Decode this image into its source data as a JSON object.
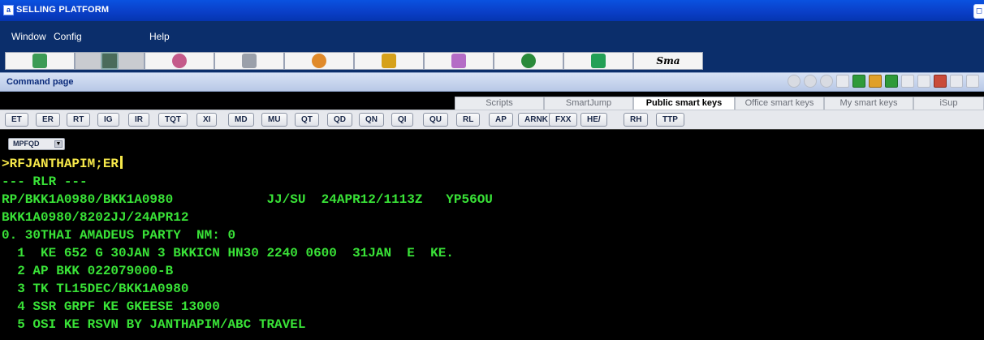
{
  "window": {
    "title": "SELLING PLATFORM",
    "app_icon": "a"
  },
  "menu": {
    "items": [
      "Window",
      "Config",
      "Help"
    ]
  },
  "toolbar": {
    "buttons": [
      {
        "icon": "book-icon",
        "color": "#3c9b55"
      },
      {
        "icon": "terminal-icon",
        "color": "#4a6b5a"
      },
      {
        "icon": "agent-icon",
        "color": "#c45a8a"
      },
      {
        "icon": "plane-icon",
        "color": "#9aa0aa"
      },
      {
        "icon": "globe-icon",
        "color": "#e08a2a"
      },
      {
        "icon": "people-icon",
        "color": "#d6a11b"
      },
      {
        "icon": "notes-icon",
        "color": "#b46cc6"
      },
      {
        "icon": "info-icon",
        "color": "#2a8a3a"
      },
      {
        "icon": "highlighter-icon",
        "color": "#23a056"
      }
    ],
    "sma_label": "Sma"
  },
  "command_page": {
    "title": "Command page"
  },
  "smartkey_tabs": [
    "Scripts",
    "SmartJump",
    "Public smart keys",
    "Office smart keys",
    "My smart keys",
    "iSup"
  ],
  "smartkeys": [
    "ET",
    "ER",
    "RT",
    "IG",
    "IR",
    "TQT",
    "XI",
    "MD",
    "MU",
    "QT",
    "QD",
    "QN",
    "QI",
    "QU",
    "RL",
    "AP",
    "ARNK",
    "FXX",
    "HE/",
    "RH",
    "TTP"
  ],
  "office_select": {
    "value": "MPFQD"
  },
  "terminal": {
    "command": ">RFJANTHAPIM;ER",
    "lines": [
      "--- RLR ---",
      "RP/BKK1A0980/BKK1A0980            JJ/SU  24APR12/1113Z   YP56OU",
      "BKK1A0980/8202JJ/24APR12",
      "0. 30THAI AMADEUS PARTY  NM: 0",
      "  1  KE 652 G 30JAN 3 BKKICN HN30 2240 0600  31JAN  E  KE.",
      "  2 AP BKK 022079000-B",
      "  3 TK TL15DEC/BKK1A0980",
      "  4 SSR GRPF KE GKEESE 13000",
      "  5 OSI KE RSVN BY JANTHAPIM/ABC TRAVEL"
    ],
    "prompt_color": "#f6e84a",
    "text_color": "#39e237"
  }
}
